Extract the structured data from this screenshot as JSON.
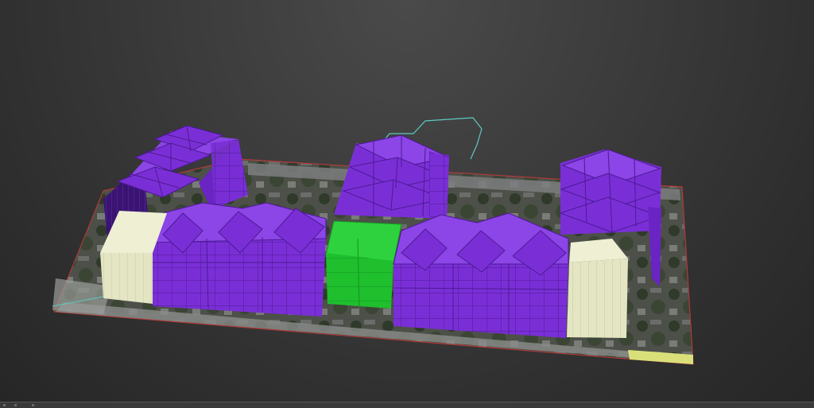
{
  "viewport": {
    "label": "",
    "colors": {
      "background": "#3b3b3b",
      "massing_purple": "#7a2fd6",
      "massing_purple_dark": "#5a1fae",
      "massing_purple_light": "#8c45e6",
      "selected_green": "#28c23a",
      "cream_block": "#e3e4c2",
      "site_outline": "#b03a3a",
      "spline_cyan": "#5fc9c2",
      "edge_highlight": "#d9e07a"
    },
    "objects": [
      "building-block-northwest",
      "building-block-north-center",
      "building-block-northeast",
      "building-block-south-west",
      "building-block-selected",
      "building-block-south-east",
      "cream-block-west",
      "cream-block-east",
      "site-aerial-plane",
      "boundary-spline"
    ]
  }
}
